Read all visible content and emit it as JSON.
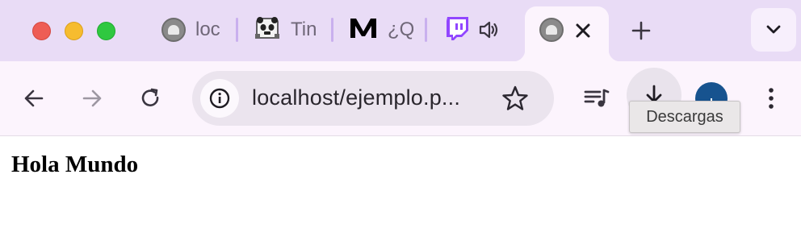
{
  "tabs": [
    {
      "title": "loc",
      "favicon": "localhost-globe-icon"
    },
    {
      "title": "Tin",
      "favicon": "panda-icon"
    },
    {
      "title": "¿Q",
      "favicon": "medium-m-icon"
    },
    {
      "title": "",
      "favicon": "twitch-icon",
      "audio": "speaker-icon"
    },
    {
      "title": "",
      "favicon": "localhost-globe-icon",
      "active": true
    }
  ],
  "omnibox": {
    "url": "localhost/ejemplo.p..."
  },
  "tooltip": {
    "text": "Descargas"
  },
  "page": {
    "heading": "Hola Mundo"
  },
  "colors": {
    "tabstrip": "#e9dcf6",
    "toolbar": "#fcf4fd",
    "avatar": "#17538f",
    "twitch": "#9146ff"
  }
}
